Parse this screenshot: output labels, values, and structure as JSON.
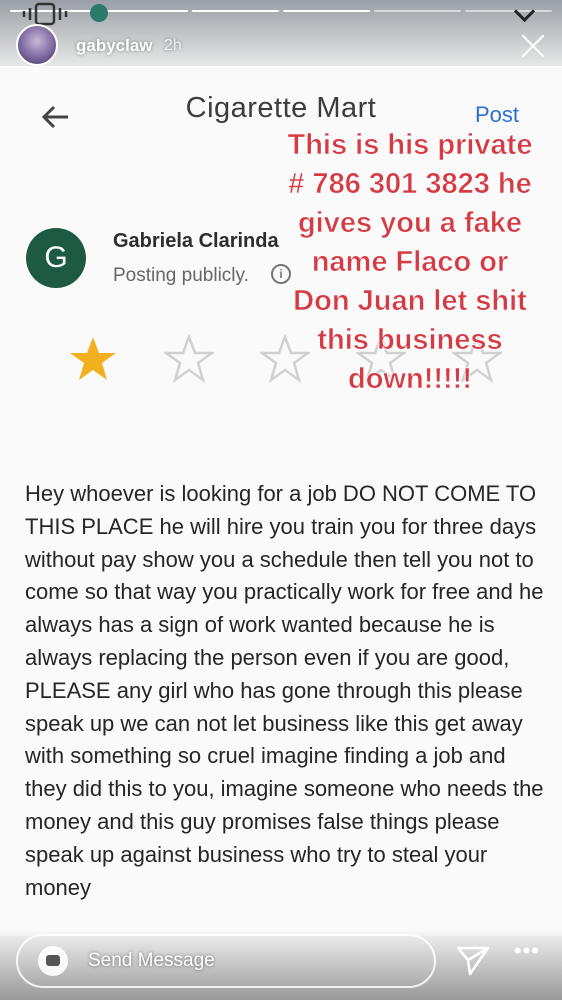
{
  "story": {
    "username": "gabyclaw",
    "time": "2h",
    "progress_segments": 6,
    "progress_done": 4
  },
  "screenshot": {
    "title": "Cigarette Mart",
    "post_label": "Post",
    "reviewer_initial": "G",
    "reviewer_name": "Gabriela Clarinda",
    "posting_status": "Posting publicly.",
    "rating": 1,
    "rating_max": 5,
    "review_text": "Hey whoever is looking for a job DO NOT COME TO THIS PLACE he will hire you train you for three days without pay  show you a schedule then tell you not to come so that way you practically work for free and he always has a sign of work wanted because he is always replacing the person even if you are good, PLEASE any girl who has gone through this please speak up we can not let business like this get away with something so cruel imagine finding a job and they did this to you, imagine someone who needs the money and this guy promises false things please speak up against business who try to steal your money"
  },
  "overlay": {
    "text": "This is his private # 786 301 3823 he gives you a fake name Flaco or Don Juan let shit this business down!!!!!",
    "color": "#d63b44"
  },
  "bottom_bar": {
    "message_placeholder": "Send Message"
  },
  "colors": {
    "link": "#2a6fd6",
    "reviewer_avatar": "#1e5a42",
    "star_filled": "#f2b01e",
    "star_empty": "#d0d0d0"
  }
}
